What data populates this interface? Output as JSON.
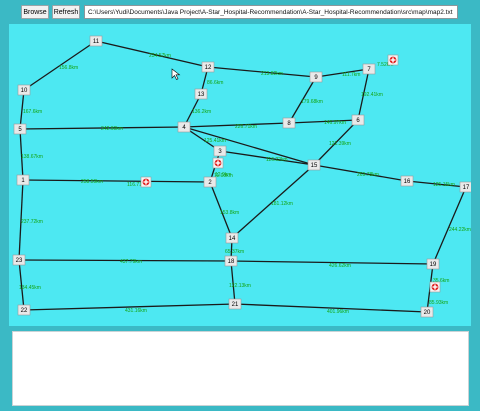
{
  "toolbar": {
    "browse_label": "Browse",
    "refresh_label": "Refresh",
    "file_path": "C:\\Users\\Yudi\\Documents\\Java Project\\A-Star_Hospital-Recommendation\\A-Star_Hospital-Recommendation\\src\\map\\map2.txt"
  },
  "map": {
    "background": "#4de8f2",
    "edge_color": "#1a1a1a",
    "edge_label_color": "#14a514",
    "hospital_icon": "hospital-cross-icon",
    "nodes": [
      {
        "id": "1"
      },
      {
        "id": "2"
      },
      {
        "id": "3"
      },
      {
        "id": "4"
      },
      {
        "id": "5"
      },
      {
        "id": "6"
      },
      {
        "id": "7"
      },
      {
        "id": "8"
      },
      {
        "id": "9"
      },
      {
        "id": "10"
      },
      {
        "id": "11"
      },
      {
        "id": "12"
      },
      {
        "id": "13"
      },
      {
        "id": "14"
      },
      {
        "id": "15"
      },
      {
        "id": "16"
      },
      {
        "id": "17"
      },
      {
        "id": "18"
      },
      {
        "id": "19"
      },
      {
        "id": "20"
      },
      {
        "id": "21"
      },
      {
        "id": "22"
      },
      {
        "id": "23"
      }
    ],
    "hospitals_near": [
      "7",
      "3",
      "2",
      "19"
    ],
    "edges": [
      {
        "from": "11",
        "to": "10",
        "label": "156.8km"
      },
      {
        "from": "11",
        "to": "12",
        "label": "234.57km"
      },
      {
        "from": "12",
        "to": "9",
        "label": "213.82km"
      },
      {
        "from": "9",
        "to": "7",
        "label": "111.7km"
      },
      {
        "from": "12",
        "to": "13",
        "label": "86.6km"
      },
      {
        "from": "13",
        "to": "4",
        "label": "136.2km"
      },
      {
        "from": "10",
        "to": "5",
        "label": "167.6km"
      },
      {
        "from": "5",
        "to": "4",
        "label": "242.60km"
      },
      {
        "from": "4",
        "to": "8",
        "label": "226.71km"
      },
      {
        "from": "8",
        "to": "6",
        "label": "146.97km"
      },
      {
        "from": "9",
        "to": "8",
        "label": "179.68km"
      },
      {
        "from": "7",
        "to": "6",
        "label": "192.41km"
      },
      {
        "from": "6",
        "to": "15",
        "label": "121.39km"
      },
      {
        "from": "4",
        "to": "3",
        "label": "125.41km"
      },
      {
        "from": "4",
        "to": "15",
        "label": ""
      },
      {
        "from": "3",
        "to": "15",
        "label": "116.22km"
      },
      {
        "from": "3",
        "to": "2",
        "label": "12.9km"
      },
      {
        "from": "5",
        "to": "1",
        "label": "138.67km"
      },
      {
        "from": "1",
        "to": "2",
        "label": "258.59km"
      },
      {
        "from": "2",
        "to": "14",
        "label": "153.8km"
      },
      {
        "from": "15",
        "to": "14",
        "label": "181.12km"
      },
      {
        "from": "15",
        "to": "16",
        "label": "269.78km"
      },
      {
        "from": "16",
        "to": "17",
        "label": "125.15km"
      },
      {
        "from": "17",
        "to": "19",
        "label": "244.22km"
      },
      {
        "from": "1",
        "to": "23",
        "label": "237.72km"
      },
      {
        "from": "14",
        "to": "18",
        "label": "65.37km"
      },
      {
        "from": "23",
        "to": "18",
        "label": "437.79km"
      },
      {
        "from": "18",
        "to": "19",
        "label": "426.62km"
      },
      {
        "from": "23",
        "to": "22",
        "label": "134.45km"
      },
      {
        "from": "18",
        "to": "21",
        "label": "122.13km"
      },
      {
        "from": "22",
        "to": "21",
        "label": "431.16km"
      },
      {
        "from": "21",
        "to": "20",
        "label": "401.96km"
      },
      {
        "from": "19",
        "to": "20",
        "label": "85.93km"
      }
    ],
    "inline_label_near_1": "116.71km",
    "inline_label_near_2": "11.08km",
    "inline_label_near_7": "7.52km",
    "inline_label_near_19": "35.6km"
  },
  "console": {
    "text": ""
  }
}
